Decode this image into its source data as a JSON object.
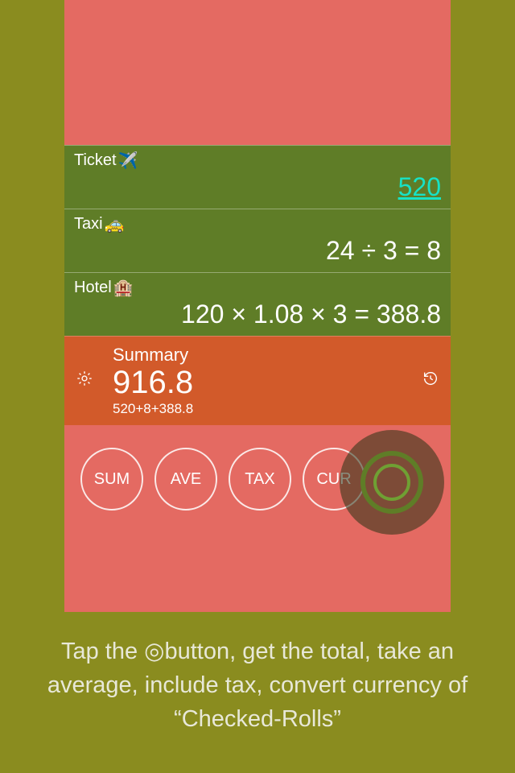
{
  "rows": [
    {
      "label": "Ticket",
      "icon": "✈️",
      "value": "520",
      "highlight": true
    },
    {
      "label": "Taxi",
      "icon": "🚕",
      "value": "24 ÷ 3 = 8",
      "highlight": false
    },
    {
      "label": "Hotel",
      "icon": "🏨",
      "value": "120 × 1.08 × 3 = 388.8",
      "highlight": false
    }
  ],
  "summary": {
    "title": "Summary",
    "total": "916.8",
    "expression": "520+8+388.8"
  },
  "ops": {
    "sum": "SUM",
    "ave": "AVE",
    "tax": "TAX",
    "cur": "CUR"
  },
  "caption": "Tap the ◎button, get the total, take an average, include tax, convert currency of “Checked-Rolls”"
}
